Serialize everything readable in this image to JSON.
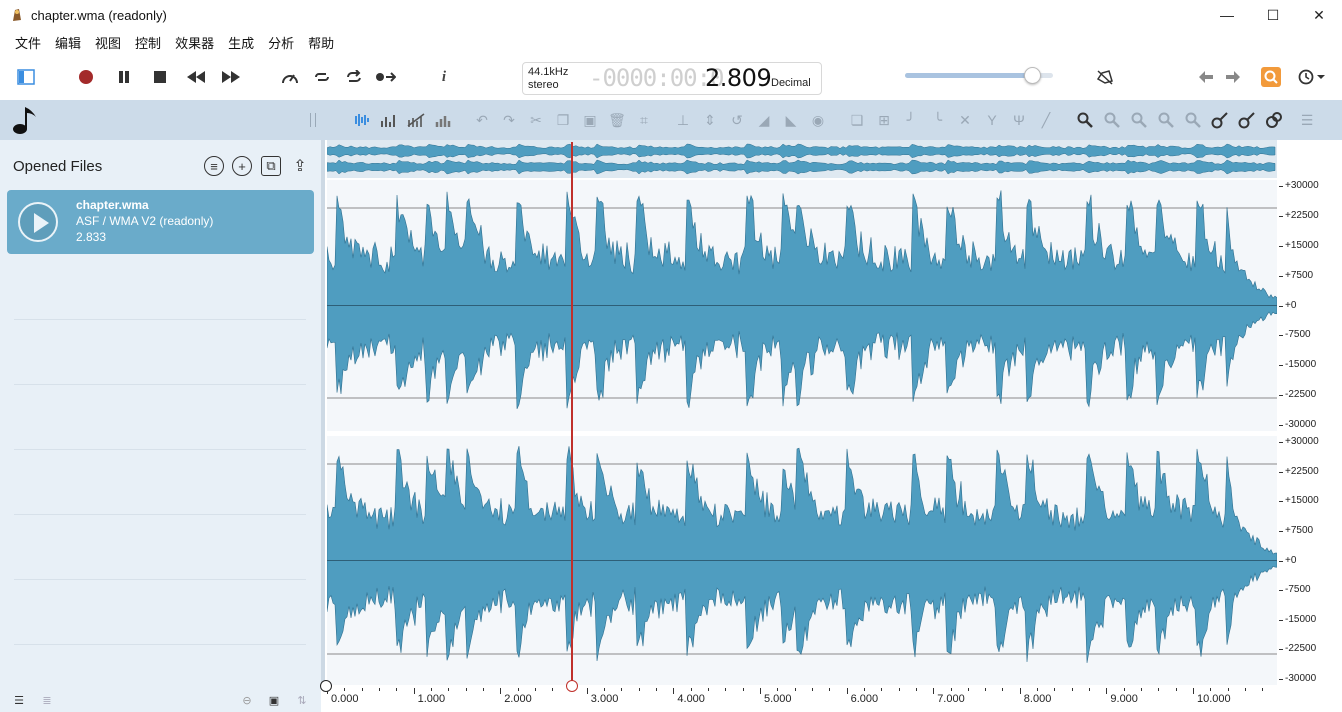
{
  "window": {
    "title": "chapter.wma (readonly)",
    "minimize": "—",
    "maximize": "☐",
    "close": "✕"
  },
  "menu": [
    "文件",
    "编辑",
    "视图",
    "控制",
    "效果器",
    "生成",
    "分析",
    "帮助"
  ],
  "transport": {
    "sample_rate": "44.1kHz",
    "channels": "stereo",
    "ghost_digits": "-0000:00:0",
    "time": "2.809",
    "format": "Decimal",
    "volume_level": 0.86
  },
  "panel": {
    "title": "Opened Files",
    "file": {
      "name": "chapter.wma",
      "format": "ASF / WMA V2 (readonly)",
      "length": "2.833"
    }
  },
  "colors": {
    "wave": "#4f9dc0",
    "wave_edge": "#2f6f8f",
    "cursor": "#c0302b",
    "panel": "#e8f0f7",
    "card": "#6aabca"
  },
  "amplitude_scale": [
    "+30000",
    "+22500",
    "+15000",
    "+7500",
    "+0",
    "-7500",
    "-15000",
    "-22500",
    "-30000"
  ],
  "timeline": [
    "0.000",
    "1.000",
    "2.000",
    "3.000",
    "4.000",
    "5.000",
    "6.000",
    "7.000",
    "8.000",
    "9.000",
    "10.000"
  ],
  "cursor_time": 2.809
}
